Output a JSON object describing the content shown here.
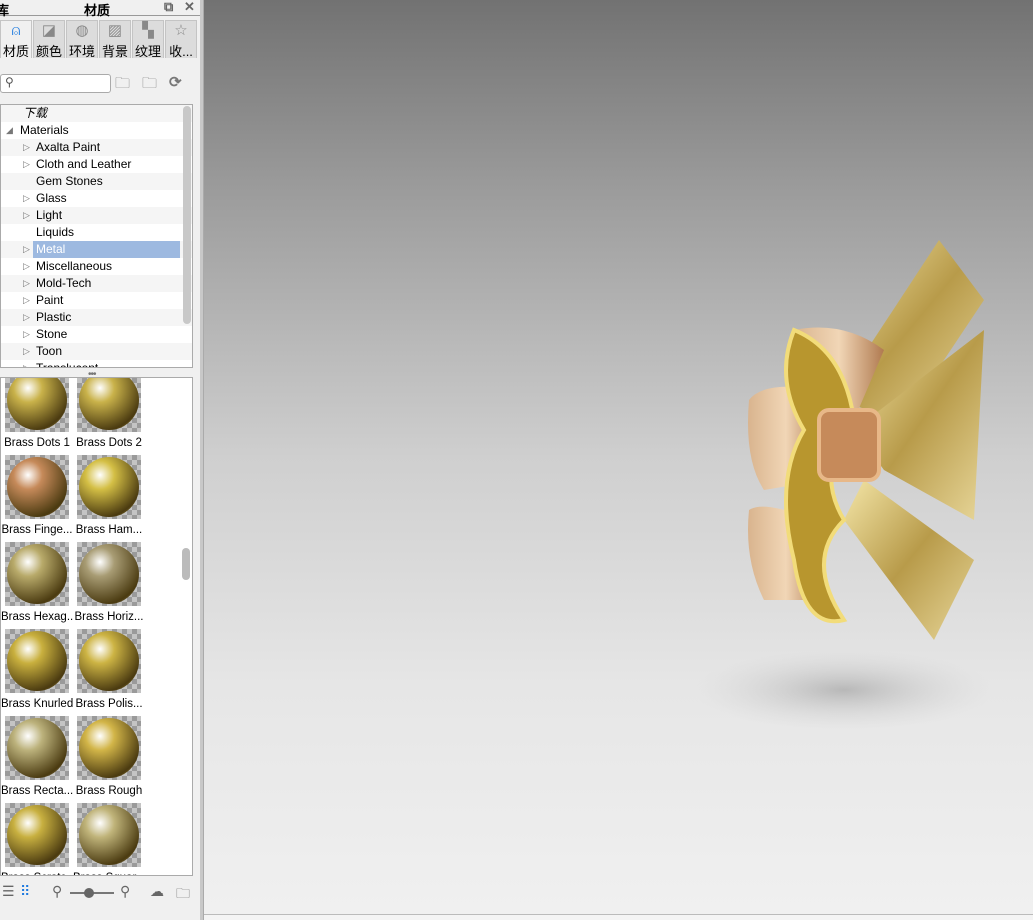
{
  "title": {
    "left": "库",
    "center": "材质",
    "restore_icon": "restore-icon",
    "close_icon": "close-icon"
  },
  "tabs": [
    {
      "label": "材质",
      "icon": "material-icon",
      "active": true
    },
    {
      "label": "颜色",
      "icon": "color-swatch-icon"
    },
    {
      "label": "环境",
      "icon": "globe-icon"
    },
    {
      "label": "背景",
      "icon": "image-icon"
    },
    {
      "label": "纹理",
      "icon": "texture-icon"
    },
    {
      "label": "收...",
      "icon": "star-icon"
    }
  ],
  "search": {
    "value": "",
    "icon": "search-icon"
  },
  "toolbar": [
    "add-folder-icon",
    "import-folder-icon",
    "refresh-icon"
  ],
  "tree": {
    "root0": "下载",
    "root1": "Materials",
    "items": [
      {
        "label": "Axalta Paint",
        "expandable": true
      },
      {
        "label": "Cloth and Leather",
        "expandable": true
      },
      {
        "label": "Gem Stones",
        "expandable": false
      },
      {
        "label": "Glass",
        "expandable": true
      },
      {
        "label": "Light",
        "expandable": true
      },
      {
        "label": "Liquids",
        "expandable": false
      },
      {
        "label": "Metal",
        "expandable": true,
        "selected": true
      },
      {
        "label": "Miscellaneous",
        "expandable": true
      },
      {
        "label": "Mold-Tech",
        "expandable": true
      },
      {
        "label": "Paint",
        "expandable": true
      },
      {
        "label": "Plastic",
        "expandable": true
      },
      {
        "label": "Stone",
        "expandable": true
      },
      {
        "label": "Toon",
        "expandable": true
      },
      {
        "label": "Translucent",
        "expandable": true
      }
    ]
  },
  "materials": [
    {
      "name": "Brass Dots 1",
      "color": "#c9b24a"
    },
    {
      "name": "Brass Dots 2",
      "color": "#c9b24a"
    },
    {
      "name": "Brass Finge...",
      "color": "#c68a5a"
    },
    {
      "name": "Brass Ham...",
      "color": "#d4bf45"
    },
    {
      "name": "Brass Hexag...",
      "color": "#b8aa6a"
    },
    {
      "name": "Brass Horiz...",
      "color": "#a89c74"
    },
    {
      "name": "Brass Knurled",
      "color": "#c9b03e"
    },
    {
      "name": "Brass Polis...",
      "color": "#cdb444"
    },
    {
      "name": "Brass Recta...",
      "color": "#bcb27c"
    },
    {
      "name": "Brass Rough",
      "color": "#d2b548"
    },
    {
      "name": "Brass Scratc...",
      "color": "#c8b040"
    },
    {
      "name": "Brass Squar...",
      "color": "#c0b47a"
    }
  ],
  "bottom": [
    "list-view-icon",
    "grid-view-icon",
    "zoom-out-icon",
    "thumbnail-size-slider",
    "zoom-in-icon",
    "upload-icon",
    "export-folder-icon"
  ],
  "thumb_size": 0.5
}
